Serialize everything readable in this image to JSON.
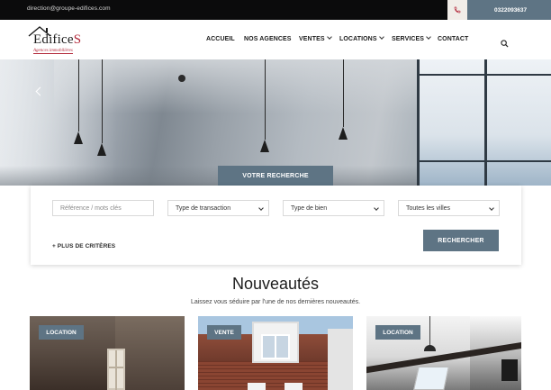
{
  "topbar": {
    "email": "direction@groupe-edifices.com",
    "phone": "0322093637",
    "phone_icon": "phone-icon"
  },
  "header": {
    "logo": {
      "brand_main": "Edifice",
      "brand_accent": "S",
      "tagline": "Agences immobilières"
    },
    "nav": [
      {
        "label": "ACCUEIL",
        "dropdown": false
      },
      {
        "label": "NOS AGENCES",
        "dropdown": false
      },
      {
        "label": "VENTES",
        "dropdown": true
      },
      {
        "label": "LOCATIONS",
        "dropdown": true
      },
      {
        "label": "SERVICES",
        "dropdown": true
      },
      {
        "label": "CONTACT",
        "dropdown": false
      }
    ],
    "search_icon": "search-icon"
  },
  "hero": {
    "tab_label": "VOTRE RECHERCHE",
    "prev_icon": "chevron-left-icon"
  },
  "search": {
    "keyword_placeholder": "Référence / mots clés",
    "transaction_selected": "Type de transaction",
    "property_selected": "Type de bien",
    "city_selected": "Toutes les villes",
    "more_criteria": "+ PLUS DE CRITÈRES",
    "submit_label": "RECHERCHER"
  },
  "news": {
    "title": "Nouveautés",
    "subtitle": "Laissez vous séduire par l'une de nos dernières nouveautés.",
    "cards": [
      {
        "badge": "LOCATION"
      },
      {
        "badge": "VENTE"
      },
      {
        "badge": "LOCATION"
      }
    ]
  },
  "colors": {
    "accent": "#5e7484",
    "topbar": "#0b0b0c",
    "brand_red": "#b2283a"
  }
}
